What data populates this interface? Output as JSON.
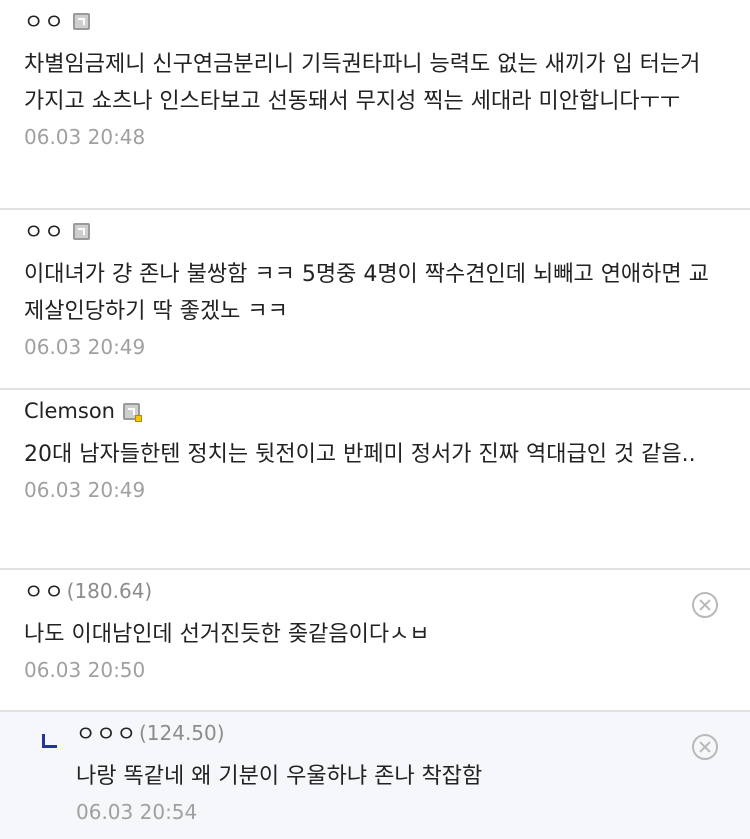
{
  "comments": [
    {
      "nick": "ㅇㅇ",
      "ip": "",
      "badge": "gallery-badge-icon",
      "body": "차별임금제니 신구연금분리니 기득권타파니 능력도 없는 새끼가 입 터는거 가지고 쇼츠나 인스타보고 선동돼서 무지성 찍는 세대라 미안합니다ㅜㅜ",
      "date": "06.03 20:48"
    },
    {
      "nick": "ㅇㅇ",
      "ip": "",
      "badge": "gallery-badge-icon",
      "body": "이대녀가 걍 존나 불쌍함 ㅋㅋ 5명중 4명이 짝수견인데 뇌빼고 연애하면 교제살인당하기 딱 좋겠노 ㅋㅋ",
      "date": "06.03 20:49"
    },
    {
      "nick": "Clemson",
      "ip": "",
      "badge": "gallery-badge-icon",
      "body": "20대 남자들한텐 정치는 뒷전이고 반페미 정서가 진짜 역대급인 것 같음..",
      "date": "06.03 20:49"
    },
    {
      "nick": "ㅇㅇ",
      "ip": "(180.64)",
      "body": "나도 이대남인데 선거진듯한 좆같음이다ㅅㅂ",
      "date": "06.03 20:50"
    },
    {
      "nick": "ㅇㅇㅇ",
      "ip": "(124.50)",
      "body": "나랑 똑같네 왜 기분이 우울하냐 존나 착잡함",
      "date": "06.03 20:54"
    }
  ]
}
